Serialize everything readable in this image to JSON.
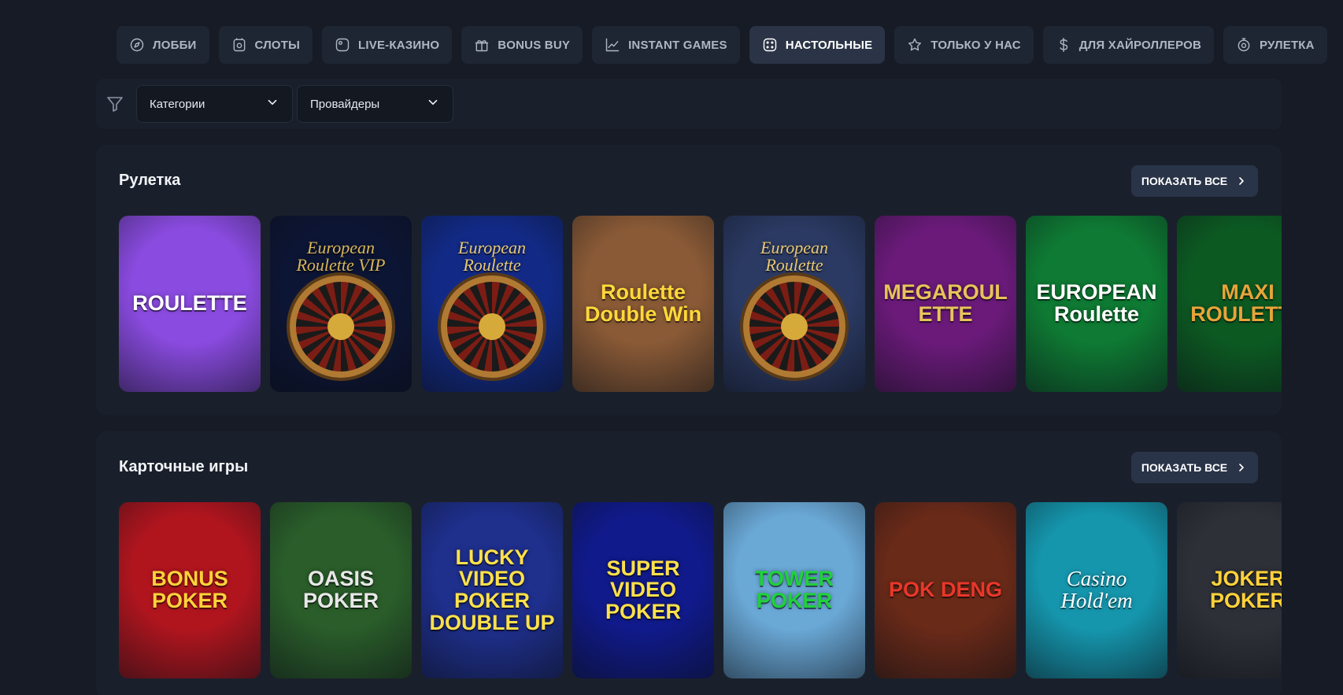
{
  "nav": {
    "items": [
      {
        "key": "lobby",
        "label": "ЛОББИ",
        "icon": "compass-icon",
        "active": false
      },
      {
        "key": "slots",
        "label": "СЛОТЫ",
        "icon": "cherry-icon",
        "active": false
      },
      {
        "key": "live",
        "label": "LIVE-КАЗИНО",
        "icon": "live-icon",
        "active": false
      },
      {
        "key": "bonus-buy",
        "label": "BONUS BUY",
        "icon": "gift-icon",
        "active": false
      },
      {
        "key": "instant",
        "label": "INSTANT GAMES",
        "icon": "chart-up-icon",
        "active": false
      },
      {
        "key": "table",
        "label": "НАСТОЛЬНЫЕ",
        "icon": "dice-icon",
        "active": true
      },
      {
        "key": "exclusive",
        "label": "ТОЛЬКО У НАС",
        "icon": "star-icon",
        "active": false
      },
      {
        "key": "highroller",
        "label": "ДЛЯ ХАЙРОЛЛЕРОВ",
        "icon": "dollar-icon",
        "active": false
      },
      {
        "key": "roulette",
        "label": "РУЛЕТКА",
        "icon": "roulette-icon",
        "active": false
      }
    ]
  },
  "filters": {
    "icon": "filter-icon",
    "categories_label": "Категории",
    "providers_label": "Провайдеры"
  },
  "sections": [
    {
      "key": "roulette",
      "title": "Рулетка",
      "show_all": "ПОКАЗАТЬ ВСЕ",
      "games": [
        {
          "title": "ROULETTE",
          "bg": "#8a4be0",
          "fg": "#ffffff",
          "style": "plain",
          "wheel": false
        },
        {
          "title": "European Roulette VIP",
          "bg": "#0c1534",
          "fg": "#d9b65a",
          "style": "script",
          "wheel": true
        },
        {
          "title": "European Roulette",
          "bg": "#122a86",
          "fg": "#e8c873",
          "style": "script",
          "wheel": true
        },
        {
          "title": "Roulette Double Win",
          "bg": "#8a5a36",
          "fg": "#ffd83a",
          "style": "plain",
          "wheel": false
        },
        {
          "title": "European Roulette",
          "bg": "#2b3a63",
          "fg": "#e8c873",
          "style": "script",
          "wheel": true
        },
        {
          "title": "MEGAROULETTE",
          "bg": "#6b1a7a",
          "fg": "#e8c35a",
          "style": "plain",
          "wheel": false
        },
        {
          "title": "EUROPEAN Roulette",
          "bg": "#0e7a33",
          "fg": "#ffffff",
          "style": "plain",
          "wheel": false
        },
        {
          "title": "MAXI ROULETTE",
          "bg": "#0c5a22",
          "fg": "#e8a43a",
          "style": "plain",
          "wheel": false
        }
      ]
    },
    {
      "key": "cards",
      "title": "Карточные игры",
      "show_all": "ПОКАЗАТЬ ВСЕ",
      "games": [
        {
          "title": "BONUS POKER",
          "bg": "#b0151e",
          "fg": "#ffd23a",
          "style": "plain",
          "wheel": false
        },
        {
          "title": "OASIS POKER",
          "bg": "#2a5d2a",
          "fg": "#e8e8e8",
          "style": "plain",
          "wheel": false
        },
        {
          "title": "LUCKY VIDEO POKER DOUBLE UP",
          "bg": "#1e2f8c",
          "fg": "#ffe14a",
          "style": "plain",
          "wheel": false
        },
        {
          "title": "SUPER VIDEO POKER",
          "bg": "#101a8a",
          "fg": "#ffe14a",
          "style": "plain",
          "wheel": false
        },
        {
          "title": "TOWER POKER",
          "bg": "#6aa8d6",
          "fg": "#1fd13a",
          "style": "plain",
          "wheel": false
        },
        {
          "title": "POK DENG",
          "bg": "#6a2a18",
          "fg": "#e8372a",
          "style": "plain",
          "wheel": false
        },
        {
          "title": "Casino Hold'em",
          "bg": "#1596ad",
          "fg": "#ffffff",
          "style": "script",
          "wheel": false
        },
        {
          "title": "JOKER POKER",
          "bg": "#2e3038",
          "fg": "#ffd23a",
          "style": "plain",
          "wheel": false
        }
      ]
    }
  ]
}
